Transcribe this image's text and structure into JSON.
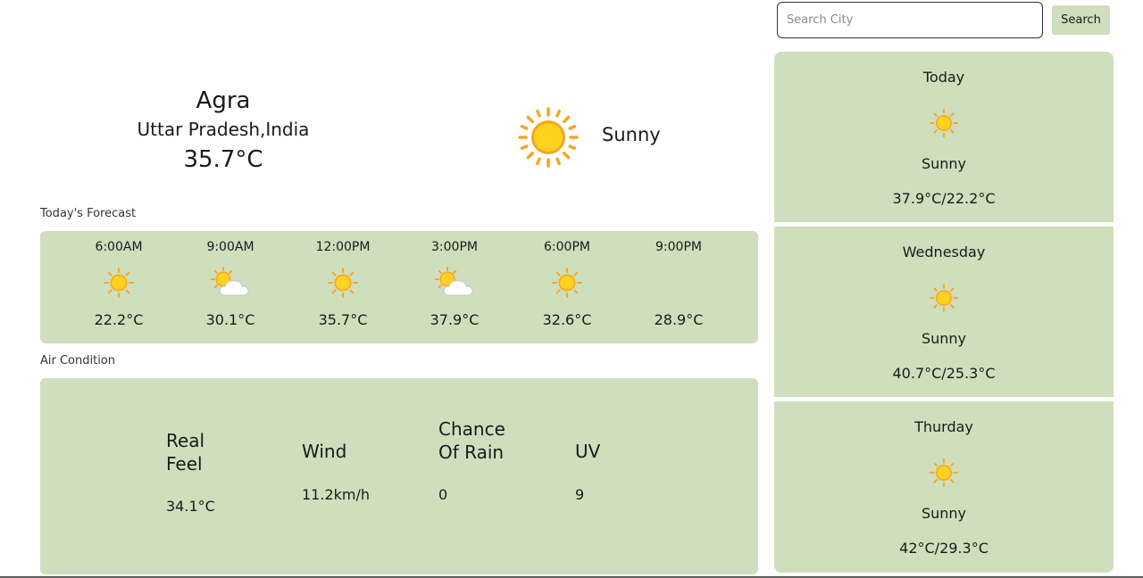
{
  "current": {
    "city": "Agra",
    "region": "Uttar Pradesh,India",
    "temperature": "35.7°C",
    "condition": "Sunny",
    "icon": "sun-icon"
  },
  "hourly": {
    "heading": "Today's Forecast",
    "items": [
      {
        "time": "6:00AM",
        "temp": "22.2°C",
        "icon": "sun-icon"
      },
      {
        "time": "9:00AM",
        "temp": "30.1°C",
        "icon": "partly-cloudy-icon"
      },
      {
        "time": "12:00PM",
        "temp": "35.7°C",
        "icon": "sun-icon"
      },
      {
        "time": "3:00PM",
        "temp": "37.9°C",
        "icon": "partly-cloudy-icon"
      },
      {
        "time": "6:00PM",
        "temp": "32.6°C",
        "icon": "sun-icon"
      },
      {
        "time": "9:00PM",
        "temp": "28.9°C",
        "icon": "moon-icon"
      }
    ]
  },
  "air": {
    "heading": "Air Condition",
    "items": [
      {
        "label": "Real Feel",
        "value": "34.1°C"
      },
      {
        "label": "Wind",
        "value": "11.2km/h"
      },
      {
        "label": "Chance Of Rain",
        "value": "0"
      },
      {
        "label": "UV",
        "value": "9"
      }
    ]
  },
  "search": {
    "placeholder": "Search City",
    "value": "",
    "button_label": "Search"
  },
  "daily": [
    {
      "day": "Today",
      "condition": "Sunny",
      "range": "37.9°C/22.2°C",
      "icon": "sun-icon"
    },
    {
      "day": "Wednesday",
      "condition": "Sunny",
      "range": "40.7°C/25.3°C",
      "icon": "sun-icon"
    },
    {
      "day": "Thurday",
      "condition": "Sunny",
      "range": "42°C/29.3°C",
      "icon": "sun-icon"
    }
  ],
  "colors": {
    "card_background": "#cfdebd",
    "sun_yellow": "#ffcc00",
    "sun_orange": "#f6a623",
    "moon_blue": "#1e72c8"
  }
}
